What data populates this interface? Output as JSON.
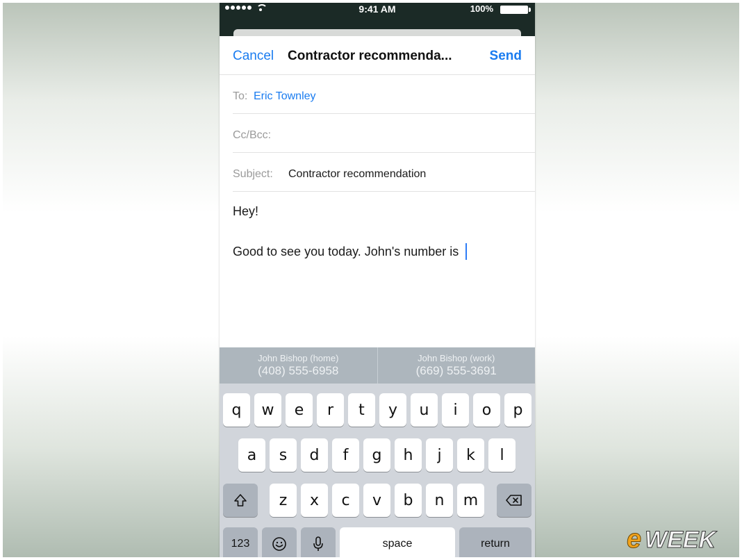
{
  "status_bar": {
    "time": "9:41 AM",
    "battery_percent": "100%"
  },
  "compose": {
    "cancel_label": "Cancel",
    "title": "Contractor recommenda...",
    "send_label": "Send",
    "to_label": "To:",
    "to_value": "Eric Townley",
    "cc_label": "Cc/Bcc:",
    "subject_label": "Subject:",
    "subject_value": "Contractor recommendation",
    "body_line1": "Hey!",
    "body_line2": "Good to see you today. John's number is"
  },
  "suggestions": [
    {
      "name": "John Bishop (home)",
      "number": "(408) 555-6958"
    },
    {
      "name": "John Bishop (work)",
      "number": "(669) 555-3691"
    }
  ],
  "keyboard": {
    "row1": [
      "q",
      "w",
      "e",
      "r",
      "t",
      "y",
      "u",
      "i",
      "o",
      "p"
    ],
    "row2": [
      "a",
      "s",
      "d",
      "f",
      "g",
      "h",
      "j",
      "k",
      "l"
    ],
    "row3": [
      "z",
      "x",
      "c",
      "v",
      "b",
      "n",
      "m"
    ],
    "numbers_label": "123",
    "space_label": "space",
    "return_label": "return",
    "shift_icon": "shift-icon",
    "delete_icon": "delete-icon",
    "emoji_icon": "emoji-icon",
    "mic_icon": "microphone-icon"
  },
  "watermark": "eWEEK",
  "colors": {
    "accent": "#1a7cf0",
    "status_bar": "#1b2a26",
    "keyboard_bg": "#d1d5db",
    "suggestion_bg": "#adb6bd"
  }
}
